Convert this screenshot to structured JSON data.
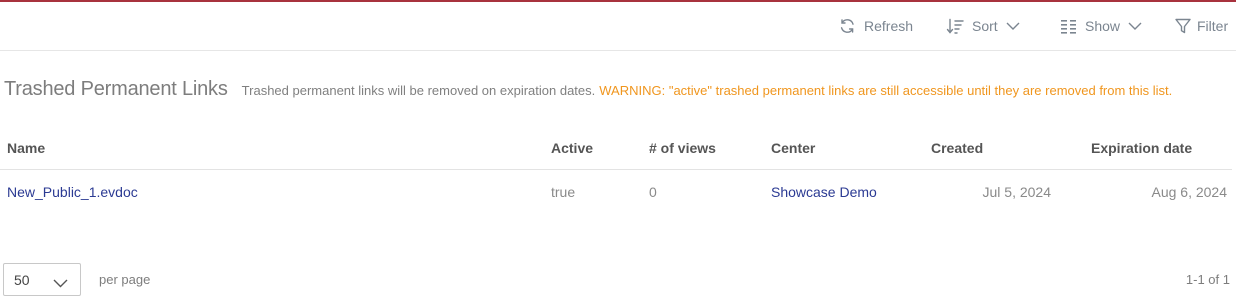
{
  "toolbar": {
    "refresh_label": "Refresh",
    "sort_label": "Sort",
    "show_label": "Show",
    "filter_label": "Filter"
  },
  "heading": {
    "title": "Trashed Permanent Links",
    "description": "Trashed permanent links will be removed on expiration dates.",
    "warning": "WARNING: \"active\" trashed permanent links are still accessible until they are removed from this list."
  },
  "table": {
    "columns": [
      "Name",
      "Active",
      "# of views",
      "Center",
      "Created",
      "Expiration date"
    ],
    "rows": [
      {
        "name": "New_Public_1.evdoc",
        "active": "true",
        "views": "0",
        "center": "Showcase Demo",
        "created": "Jul 5, 2024",
        "expiration": "Aug 6, 2024"
      }
    ]
  },
  "pagination": {
    "per_page_value": "50",
    "per_page_label": "per page",
    "range": "1-1 of 1"
  },
  "colors": {
    "accent_top_bar": "#a8323e",
    "link": "#2b3a93",
    "warning": "#f0961e",
    "toolbar_text": "#7b8590"
  },
  "icons": {
    "refresh": "refresh-icon",
    "sort": "sort-icon",
    "show": "columns-icon",
    "filter": "filter-icon",
    "chevron": "chevron-down-icon"
  }
}
